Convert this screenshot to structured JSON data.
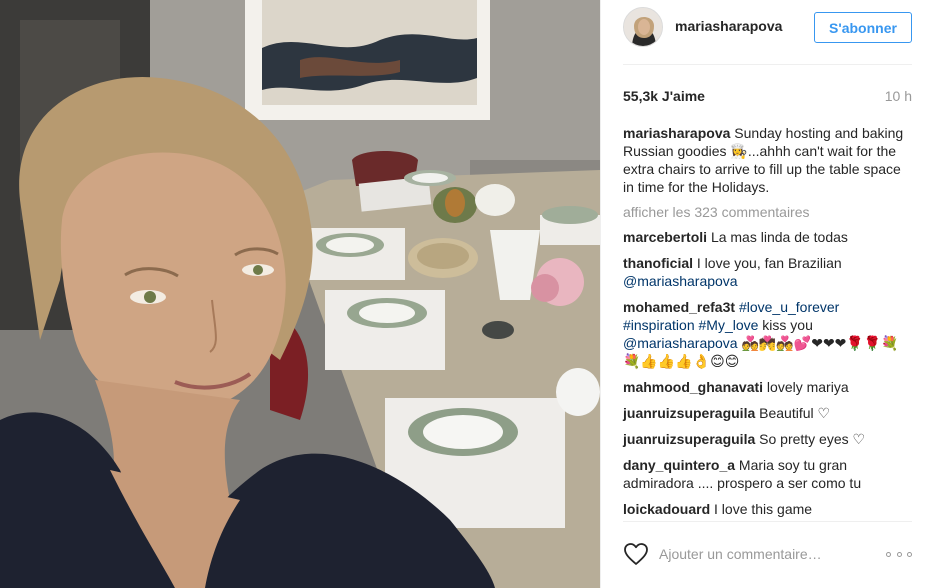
{
  "post": {
    "photo_alt": "Selfie with table set for dinner"
  },
  "header": {
    "username": "mariasharapova",
    "follow_label": "S'abonner"
  },
  "stats": {
    "likes": "55,3k J'aime",
    "time": "10 h"
  },
  "caption": {
    "username": "mariasharapova",
    "text": "Sunday hosting and baking Russian goodies 👩‍🍳...ahhh can't wait for the extra chairs to arrive to fill up the table space in time for the Holidays."
  },
  "more_comments": "afficher les 323 commentaires",
  "comments": [
    {
      "username": "marcebertoli",
      "text": "La mas linda de todas"
    },
    {
      "username": "thanoficial",
      "text": "I love you, fan Brazilian ",
      "mention": "@mariasharapova"
    },
    {
      "username": "mohamed_refa3t",
      "tag1": "#love_u_forever",
      "tag2": "#inspiration",
      "tag3": "#My_love",
      "text_mid": " kiss you ",
      "mention": "@mariasharapova",
      "text_end": " 💑💏💑💕❤❤❤🌹🌹💐💐👍👍👍👌😊😊"
    },
    {
      "username": "mahmood_ghanavati",
      "text": "lovely mariya"
    },
    {
      "username": "juanruizsuperaguila",
      "text": "Beautiful ♡"
    },
    {
      "username": "juanruizsuperaguila",
      "text": "So pretty eyes ♡"
    },
    {
      "username": "dany_quintero_a",
      "text": "Maria soy tu gran admiradora .... prospero a ser como tu"
    },
    {
      "username": "loickadouard",
      "text": "I love this game"
    }
  ],
  "footer": {
    "comment_placeholder": "Ajouter un commentaire…"
  },
  "colors": {
    "accent": "#3897f0",
    "link": "#003569",
    "muted": "#999999"
  },
  "icons": {
    "like": "heart-outline-icon",
    "more": "more-options-icon"
  }
}
